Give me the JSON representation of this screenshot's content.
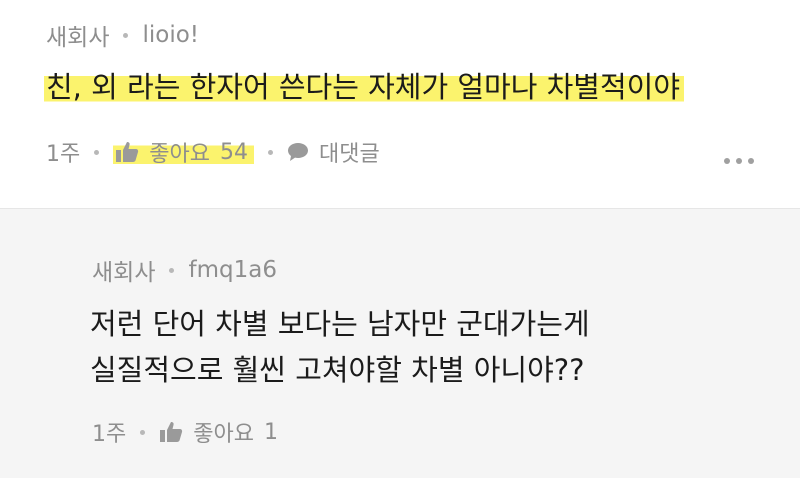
{
  "comments": [
    {
      "badge": "새회사",
      "author": "lioio!",
      "text": "친, 외 라는 한자어 쓴다는 자체가 얼마나 차별적이야",
      "time": "1주",
      "like_label": "좋아요",
      "like_count": "54",
      "reply_label": "대댓글"
    },
    {
      "badge": "새회사",
      "author": "fmq1a6",
      "text_lines": [
        "저런 단어 차별 보다는 남자만 군대가는게",
        "실질적으로 훨씬 고쳐야할 차별 아니야??"
      ],
      "time": "1주",
      "like_label": "좋아요",
      "like_count": "1"
    }
  ],
  "icons": [
    "thumbs-up-icon",
    "speech-bubble-icon",
    "more-options-icon"
  ],
  "colors": {
    "highlight": "#fbf36d",
    "muted_text": "#8e8e8e",
    "reply_bg": "#f5f5f5"
  }
}
